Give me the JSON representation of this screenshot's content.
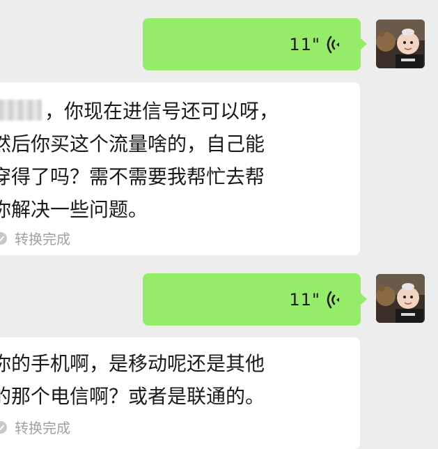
{
  "messages": [
    {
      "type": "voice",
      "sender": "me",
      "duration": "11\""
    },
    {
      "type": "transcript",
      "lines": [
        "，你现在进信号还可以呀，",
        "然后你买这个流量啥的，自己能",
        "穿得了吗？需不需要我帮忙去帮",
        "你解决一些问题。"
      ],
      "status": "转换完成"
    },
    {
      "type": "voice",
      "sender": "me",
      "duration": "11\""
    },
    {
      "type": "transcript",
      "lines": [
        "你的手机啊，是移动呢还是其他",
        "的那个电信啊？或者是联通的。"
      ],
      "status": "转换完成"
    }
  ],
  "icons": {
    "voice": "voice-wave-icon",
    "status": "check-circle-icon",
    "avatar": "baby-avatar"
  },
  "colors": {
    "background": "#ededed",
    "my_bubble": "#95ec69",
    "card": "#ffffff",
    "status_text": "#a0a0a0"
  }
}
